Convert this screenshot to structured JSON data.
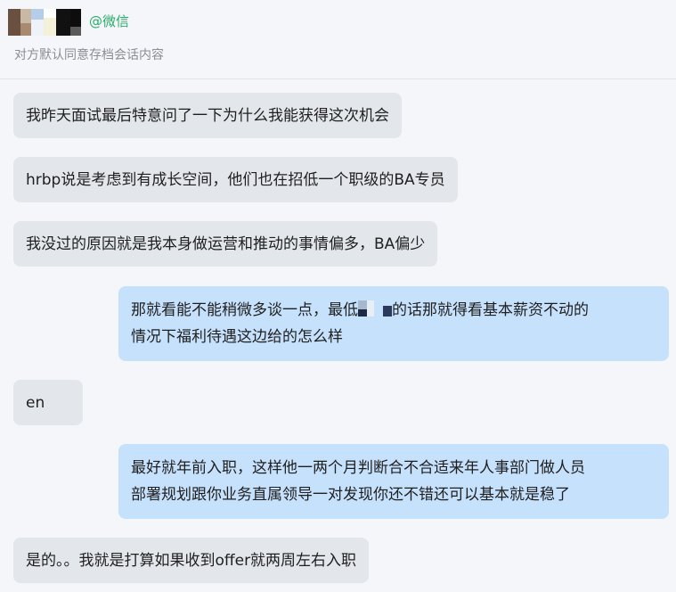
{
  "header": {
    "contact_name": "@微信",
    "notice": "对方默认同意存档会话内容"
  },
  "messages": [
    {
      "side": "left",
      "text": "我昨天面试最后特意问了一下为什么我能获得这次机会"
    },
    {
      "side": "left",
      "text": "hrbp说是考虑到有成长空间，他们也在招低一个职级的BA专员"
    },
    {
      "side": "left",
      "text": "我没过的原因就是我本身做运营和推动的事情偏多，BA偏少"
    },
    {
      "side": "right",
      "text_before": "那就看能不能稍微多谈一点，最低",
      "text_after": "的话那就得看基本薪资不动的",
      "line2": "情况下福利待遇这边给的怎么样"
    },
    {
      "side": "left",
      "text": "en"
    },
    {
      "side": "right",
      "line1": "最好就年前入职，这样他一两个月判断合不合适来年人事部门做人员",
      "line2": "部署规划跟你业务直属领导一对发现你还不错还可以基本就是稳了"
    },
    {
      "side": "left",
      "text": "是的。。我就是打算如果收到offer就两周左右入职"
    }
  ]
}
